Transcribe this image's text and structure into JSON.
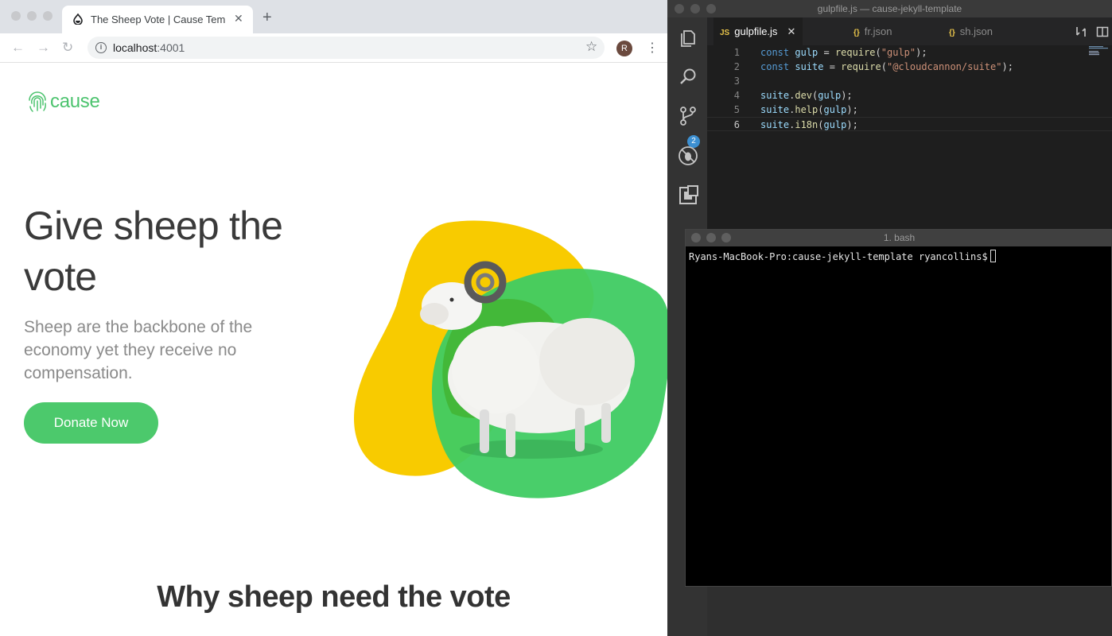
{
  "browser": {
    "tab_title": "The Sheep Vote | Cause Templ",
    "new_tab_symbol": "+",
    "url_host": "localhost",
    "url_port": ":4001",
    "avatar_letter": "R"
  },
  "site": {
    "logo_text": "cause",
    "hero_title": "Give sheep the vote",
    "hero_subtitle": "Sheep are the backbone of the economy yet they receive no compensation.",
    "donate_label": "Donate Now",
    "section_heading": "Why sheep need the vote",
    "colors": {
      "green": "#4cc96c",
      "yellow": "#f8cb00"
    }
  },
  "editor": {
    "window_title": "gulpfile.js — cause-jekyll-template",
    "tabs": [
      {
        "icon": "JS",
        "label": "gulpfile.js",
        "active": true
      },
      {
        "icon": "{}",
        "label": "fr.json",
        "active": false
      },
      {
        "icon": "{}",
        "label": "sh.json",
        "active": false
      }
    ],
    "scm_badge": "2",
    "lines": [
      {
        "num": "1",
        "text": "const gulp = require(\"gulp\");"
      },
      {
        "num": "2",
        "text": "const suite = require(\"@cloudcannon/suite\");"
      },
      {
        "num": "3",
        "text": ""
      },
      {
        "num": "4",
        "text": "suite.dev(gulp);"
      },
      {
        "num": "5",
        "text": "suite.help(gulp);"
      },
      {
        "num": "6",
        "text": "suite.i18n(gulp);"
      }
    ]
  },
  "terminal": {
    "title": "1. bash",
    "prompt": "Ryans-MacBook-Pro:cause-jekyll-template ryancollins$"
  }
}
